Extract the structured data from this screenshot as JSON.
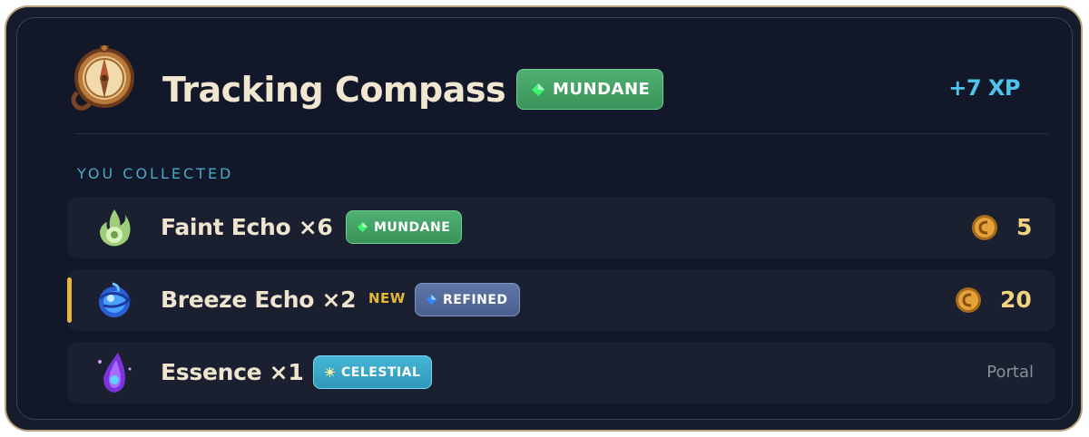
{
  "item": {
    "title": "Tracking Compass",
    "rarity": "MUNDANE",
    "xp": "+7 XP",
    "icon": "compass-icon"
  },
  "section_title": "YOU COLLECTED",
  "rows": [
    {
      "label": "Faint Echo ×6",
      "rarity": "MUNDANE",
      "new": "",
      "price": "5",
      "icon": "green-flame-echo-icon"
    },
    {
      "label": "Breeze Echo ×2",
      "rarity": "REFINED",
      "new": "NEW",
      "price": "20",
      "icon": "blue-swirl-echo-icon"
    },
    {
      "label": "Essence ×1",
      "rarity": "CELESTIAL",
      "new": "",
      "price": "Portal",
      "icon": "purple-essence-drop-icon"
    }
  ],
  "colors": {
    "mundane": "#3fa565",
    "refined": "#566c9c",
    "celestial": "#3aaed0",
    "xp": "#4fc3ec",
    "price": "#f2d37f",
    "new_accent": "#e8b63c"
  }
}
